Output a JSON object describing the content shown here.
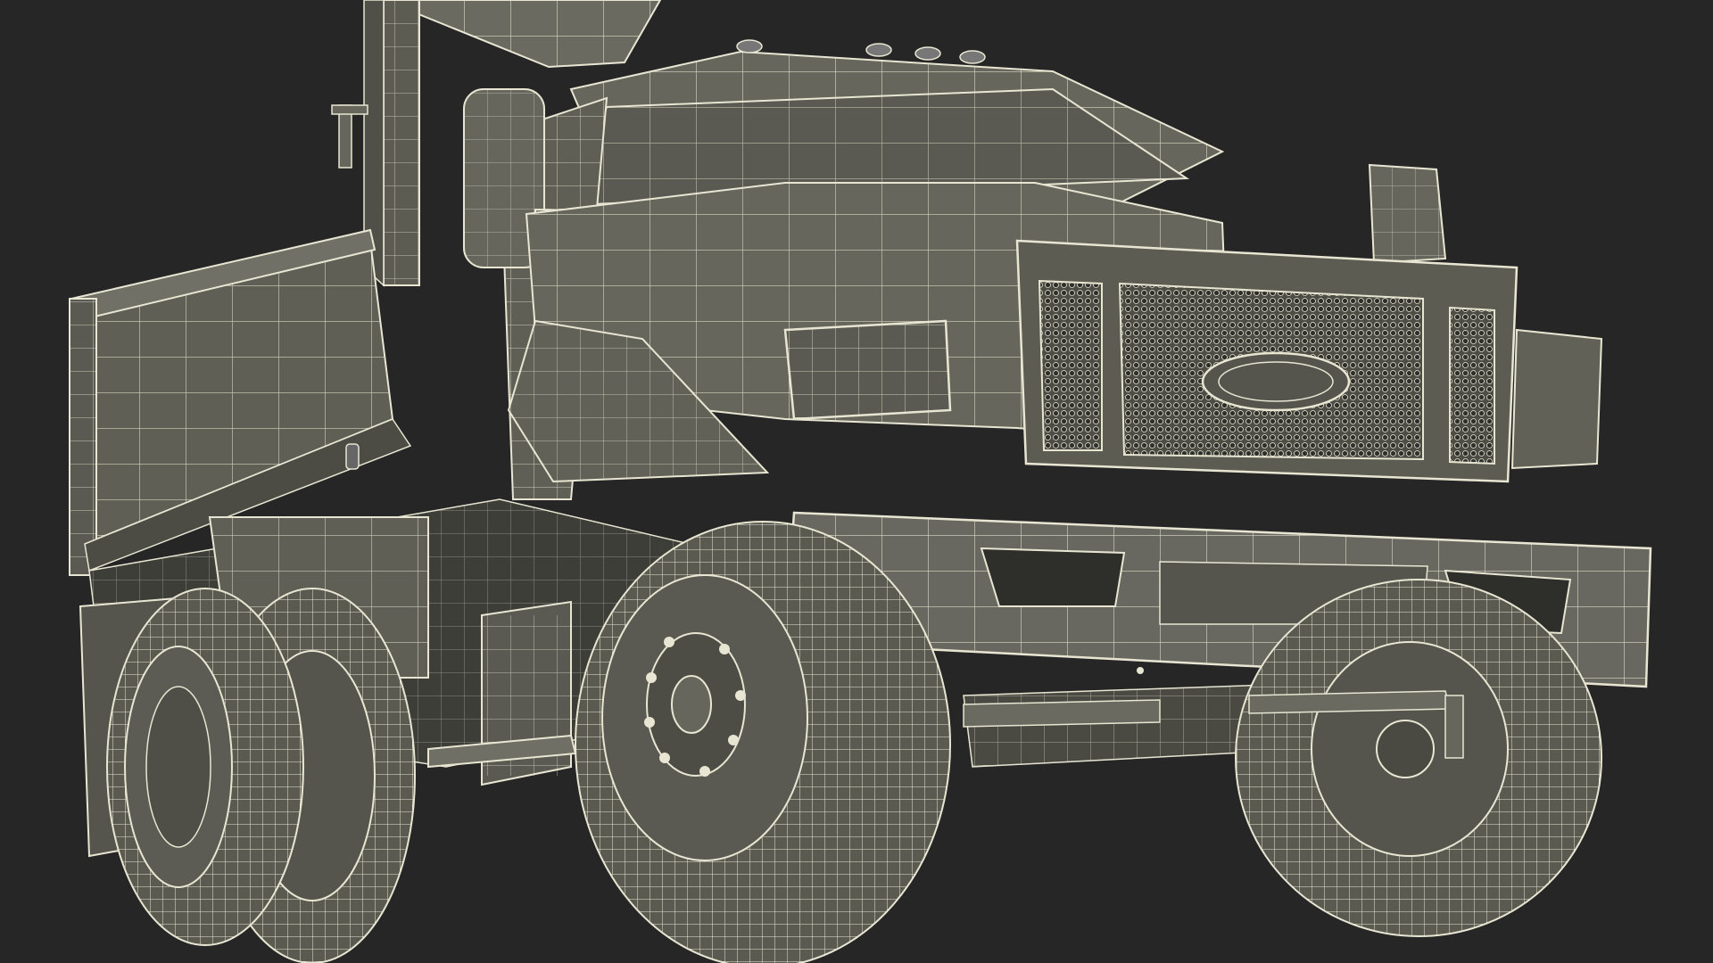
{
  "scene": {
    "subject": "dump-truck-wireframe",
    "palette": {
      "background": "#262626",
      "surface": "#5f5f56",
      "surface_dark": "#4a4a43",
      "surface_light": "#6e6e64",
      "wire": "#e8e6d2",
      "tire": "#595950"
    }
  }
}
